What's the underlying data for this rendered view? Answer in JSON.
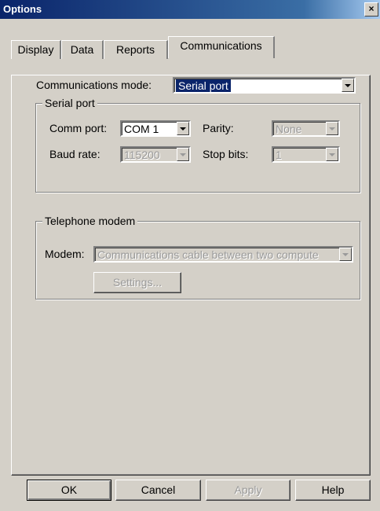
{
  "window": {
    "title": "Options",
    "close_glyph": "×"
  },
  "tabs": [
    {
      "label": "Display",
      "active": false
    },
    {
      "label": "Data",
      "active": false
    },
    {
      "label": "Reports",
      "active": false
    },
    {
      "label": "Communications",
      "active": true
    }
  ],
  "communications": {
    "mode_label": "Communications mode:",
    "mode_value": "Serial port"
  },
  "serial_port": {
    "group_title": "Serial port",
    "comm_port_label": "Comm port:",
    "comm_port_value": "COM 1",
    "parity_label": "Parity:",
    "parity_value": "None",
    "baud_rate_label": "Baud rate:",
    "baud_rate_value": "115200",
    "stop_bits_label": "Stop bits:",
    "stop_bits_value": "1"
  },
  "telephone_modem": {
    "group_title": "Telephone modem",
    "modem_label": "Modem:",
    "modem_value": "Communications cable between two compute",
    "settings_button": "Settings..."
  },
  "buttons": {
    "ok": "OK",
    "cancel": "Cancel",
    "apply": "Apply",
    "help": "Help"
  }
}
